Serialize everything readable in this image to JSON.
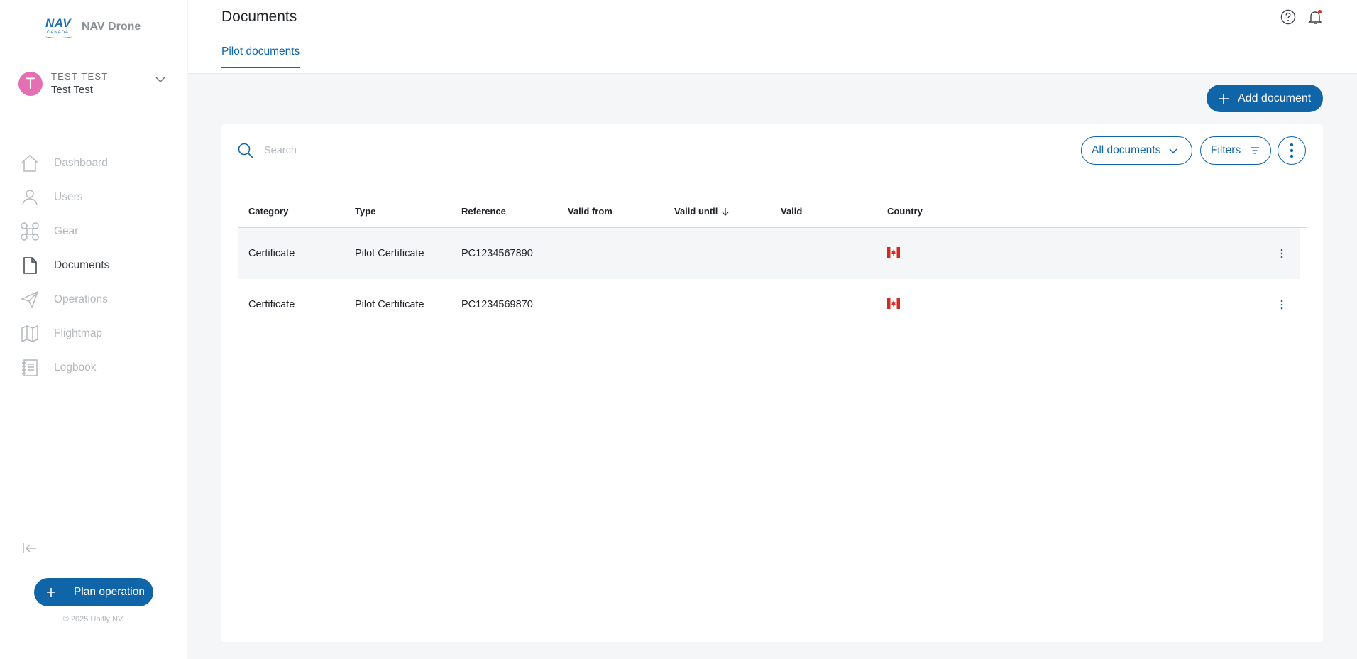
{
  "brand": {
    "logo_text": "NAV",
    "logo_sub": "CANADA",
    "name": "NAV Drone"
  },
  "user": {
    "initial": "T",
    "org": "TEST TEST",
    "name": "Test Test"
  },
  "nav": {
    "items": [
      {
        "label": "Dashboard",
        "icon": "home-icon"
      },
      {
        "label": "Users",
        "icon": "user-icon"
      },
      {
        "label": "Gear",
        "icon": "drone-icon"
      },
      {
        "label": "Documents",
        "icon": "document-icon"
      },
      {
        "label": "Operations",
        "icon": "paper-plane-icon"
      },
      {
        "label": "Flightmap",
        "icon": "map-icon"
      },
      {
        "label": "Logbook",
        "icon": "logbook-icon"
      }
    ],
    "active": "Documents"
  },
  "plan_button": {
    "label": "Plan operation"
  },
  "copyright": "© 2025 Unifly NV.",
  "header": {
    "title": "Documents",
    "tab": "Pilot documents"
  },
  "add_button": {
    "label": "Add document"
  },
  "search": {
    "placeholder": "Search"
  },
  "filters": {
    "documents_select": "All documents",
    "filters_label": "Filters"
  },
  "table": {
    "headers": [
      "Category",
      "Type",
      "Reference",
      "Valid from",
      "Valid until",
      "Valid",
      "Country"
    ],
    "sort_column": "Valid until",
    "sort_direction": "descending",
    "rows": [
      {
        "category": "Certificate",
        "type": "Pilot Certificate",
        "reference": "PC1234567890",
        "valid_from": "",
        "valid_until": "",
        "valid": "",
        "country": "canada-flag-icon"
      },
      {
        "category": "Certificate",
        "type": "Pilot Certificate",
        "reference": "PC1234569870",
        "valid_from": "",
        "valid_until": "",
        "valid": "",
        "country": "canada-flag-icon"
      }
    ]
  },
  "colors": {
    "primary": "#1064a8",
    "avatar": "#e46fb3",
    "notification_dot": "#e0322c",
    "flag_red": "#d52b1e"
  }
}
